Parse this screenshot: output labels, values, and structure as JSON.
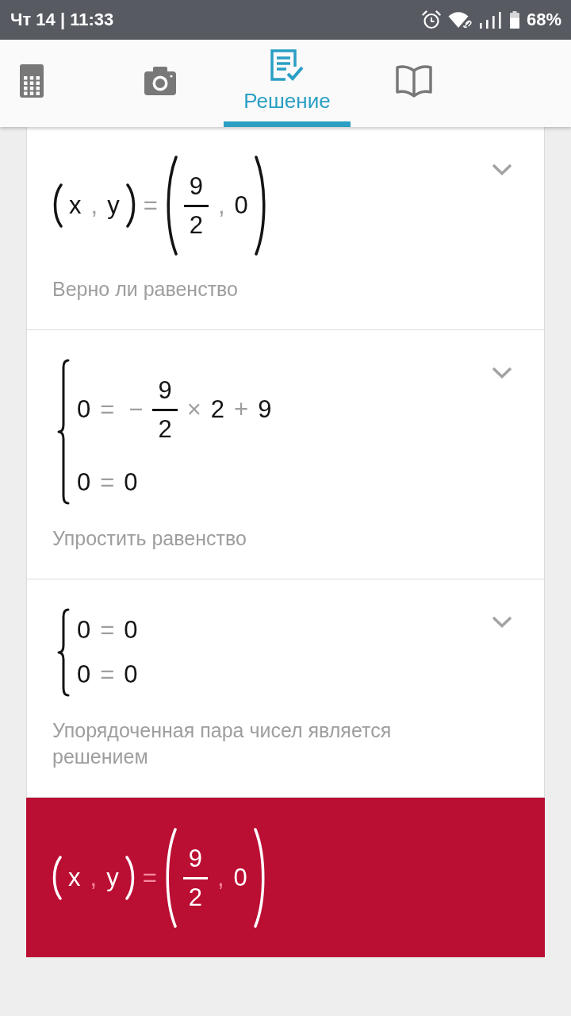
{
  "status_bar": {
    "time": "Чт 14 | 11:33",
    "battery": "68%"
  },
  "tabs": [
    {
      "kind": "calculator",
      "selected": false
    },
    {
      "kind": "camera",
      "selected": false
    },
    {
      "kind": "solution",
      "label": "Решение",
      "selected": true
    },
    {
      "kind": "book",
      "selected": false
    }
  ],
  "steps": [
    {
      "expanded": false,
      "math": [
        {
          "kind": "group",
          "children": [
            {
              "kind": "term",
              "text": "x"
            },
            {
              "kind": "op",
              "text": ","
            },
            {
              "kind": "term",
              "text": "y"
            }
          ]
        },
        {
          "kind": "op",
          "text": "="
        },
        {
          "kind": "group",
          "children": [
            {
              "kind": "frac",
              "num": "9",
              "den": "2"
            },
            {
              "kind": "op",
              "text": ","
            },
            {
              "kind": "term",
              "text": "0"
            }
          ]
        }
      ],
      "caption": "Верно ли равенство"
    },
    {
      "expanded": false,
      "math": [
        {
          "kind": "system",
          "rows": [
            [
              {
                "kind": "term",
                "text": "0"
              },
              {
                "kind": "op",
                "text": "="
              },
              {
                "kind": "op",
                "text": "−"
              },
              {
                "kind": "frac",
                "num": "9",
                "den": "2"
              },
              {
                "kind": "op",
                "text": "×"
              },
              {
                "kind": "term",
                "text": "2"
              },
              {
                "kind": "op",
                "text": "+"
              },
              {
                "kind": "term",
                "text": "9"
              }
            ],
            [
              {
                "kind": "term",
                "text": "0"
              },
              {
                "kind": "op",
                "text": "="
              },
              {
                "kind": "term",
                "text": "0"
              }
            ]
          ]
        }
      ],
      "caption": "Упростить равенство"
    },
    {
      "expanded": false,
      "math": [
        {
          "kind": "system",
          "rows": [
            [
              {
                "kind": "term",
                "text": "0"
              },
              {
                "kind": "op",
                "text": "="
              },
              {
                "kind": "term",
                "text": "0"
              }
            ],
            [
              {
                "kind": "term",
                "text": "0"
              },
              {
                "kind": "op",
                "text": "="
              },
              {
                "kind": "term",
                "text": "0"
              }
            ]
          ]
        }
      ],
      "caption": "Упорядоченная пара чисел является решением"
    }
  ],
  "result": {
    "math": [
      {
        "kind": "group",
        "children": [
          {
            "kind": "term",
            "text": "x"
          },
          {
            "kind": "op",
            "text": ","
          },
          {
            "kind": "term",
            "text": "y"
          }
        ]
      },
      {
        "kind": "op",
        "text": "="
      },
      {
        "kind": "group",
        "children": [
          {
            "kind": "frac",
            "num": "9",
            "den": "2"
          },
          {
            "kind": "op",
            "text": ","
          },
          {
            "kind": "term",
            "text": "0"
          }
        ]
      }
    ]
  }
}
